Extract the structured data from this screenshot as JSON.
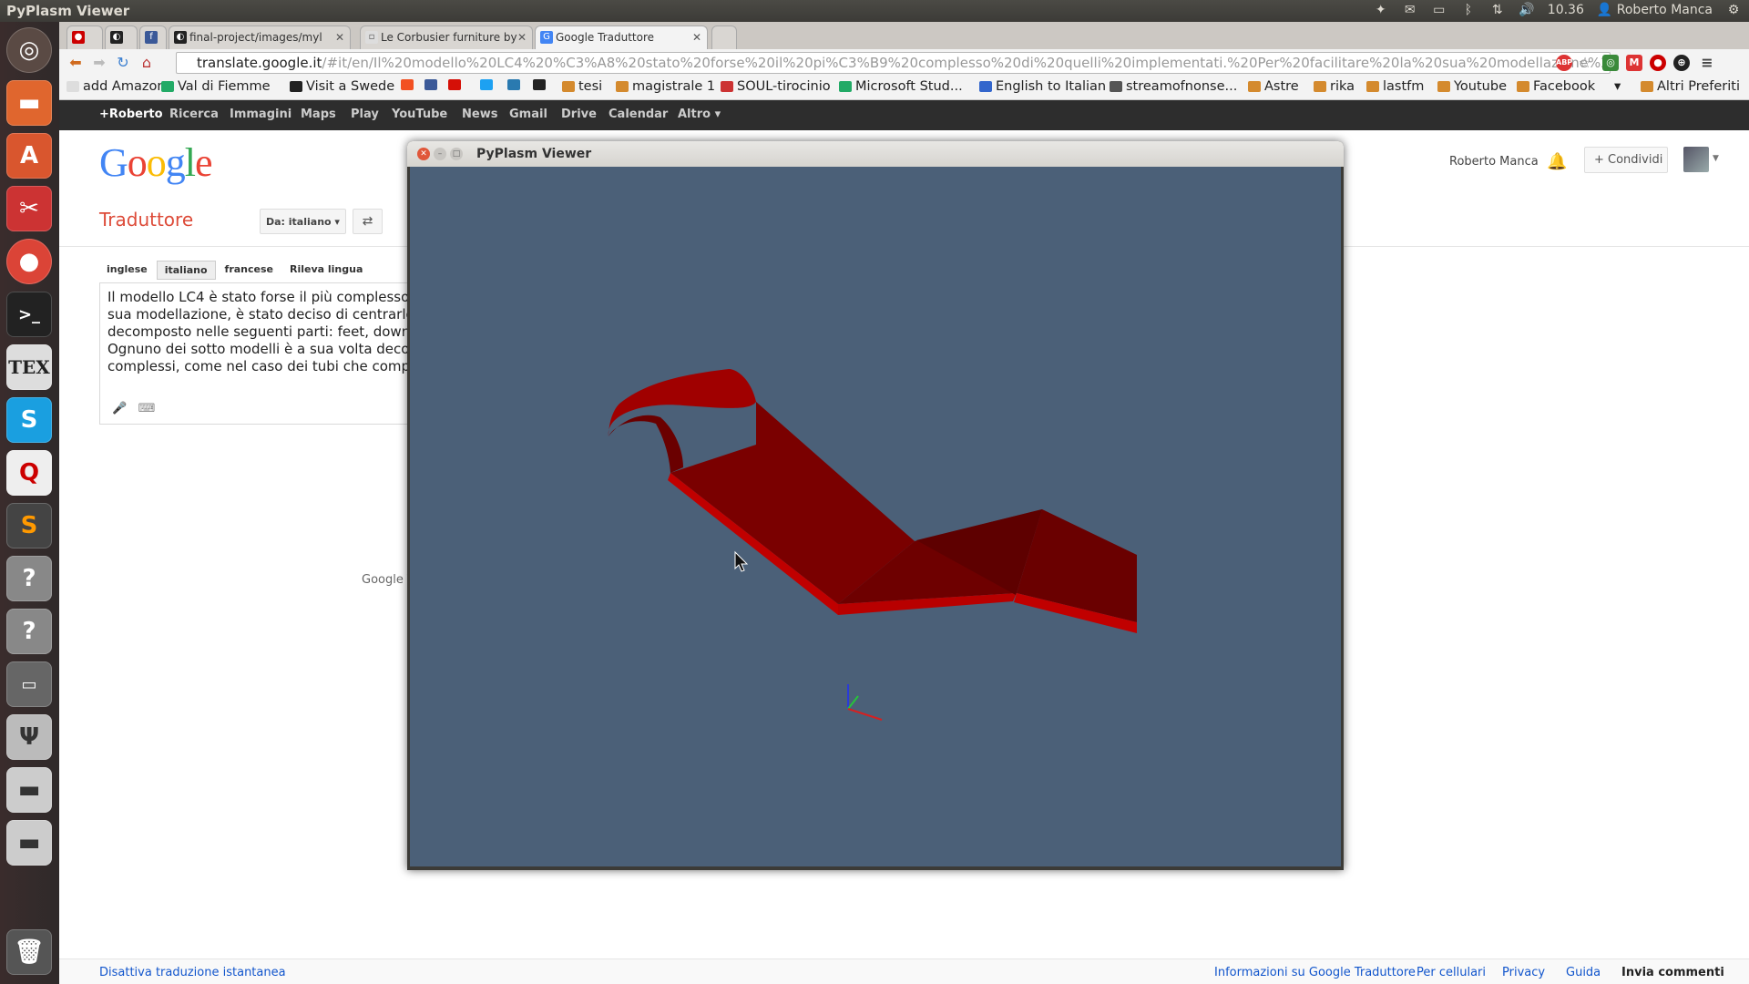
{
  "top_panel": {
    "app_title": "PyPlasm Viewer",
    "time": "10.36",
    "user": "Roberto Manca"
  },
  "launcher": {
    "items": [
      "dash-icon",
      "files-icon",
      "software-center-icon",
      "settings-icon",
      "chrome-icon",
      "terminal-icon",
      "tex-icon",
      "skype-icon",
      "search-tool-icon",
      "sublime-icon",
      "unknown-app-icon",
      "unknown-app-icon",
      "window-icon",
      "usb-icon",
      "drive-icon",
      "drive-icon",
      "trash-icon"
    ]
  },
  "tabs": [
    {
      "label": ""
    },
    {
      "label": ""
    },
    {
      "label": "final-project/images/myl"
    },
    {
      "label": "Le Corbusier furniture by"
    },
    {
      "label": "Google Traduttore"
    }
  ],
  "toolbar": {
    "url_host": "translate.google.it",
    "url_path": "/#it/en/Il%20modello%20LC4%20%C3%A8%20stato%20forse%20il%20pi%C3%B9%20complesso%20di%20quelli%20implementati.%20Per%20facilitare%20la%20sua%20modellazione%2C%20%C3%A8"
  },
  "bookmarks": [
    {
      "label": "add Amazon"
    },
    {
      "label": "Val di Fiemme"
    },
    {
      "label": "Visit a Swede"
    },
    {
      "label": "tesi"
    },
    {
      "label": "magistrale 1"
    },
    {
      "label": "SOUL-tirocinio"
    },
    {
      "label": "Microsoft Stud..."
    },
    {
      "label": "English to Italian"
    },
    {
      "label": "streamofnonse..."
    },
    {
      "label": "Astre"
    },
    {
      "label": "rika"
    },
    {
      "label": "lastfm"
    },
    {
      "label": "Youtube"
    },
    {
      "label": "Facebook"
    },
    {
      "label": "Altri Preferiti"
    }
  ],
  "gbar": [
    "+Roberto",
    "Ricerca",
    "Immagini",
    "Maps",
    "Play",
    "YouTube",
    "News",
    "Gmail",
    "Drive",
    "Calendar",
    "Altro ▾"
  ],
  "translate": {
    "title": "Traduttore",
    "from_label": "Da: italiano ▾",
    "lang_tabs": [
      "inglese",
      "italiano",
      "francese",
      "Rileva lingua"
    ],
    "source_text": "Il modello LC4 è stato forse il più complesso di\nsua modellazione, è stato deciso di centrarlo lu\ndecomposto nelle seguenti parti:  feet, down pi\nOgnuno dei sotto modelli è a sua volta decomp\ncomplessi, come nel caso dei tubi che compon",
    "partial_footer": "Google T",
    "user": "Roberto Manca",
    "share": "+  Condividi"
  },
  "footer": {
    "left": "Disattiva traduzione istantanea",
    "links": [
      "Informazioni su Google Traduttore",
      "Per cellulari",
      "Privacy",
      "Guida",
      "Invia commenti"
    ]
  },
  "pyplasm": {
    "title": "PyPlasm Viewer",
    "model_color": "#8b0000",
    "background_color": "#4b6078"
  }
}
